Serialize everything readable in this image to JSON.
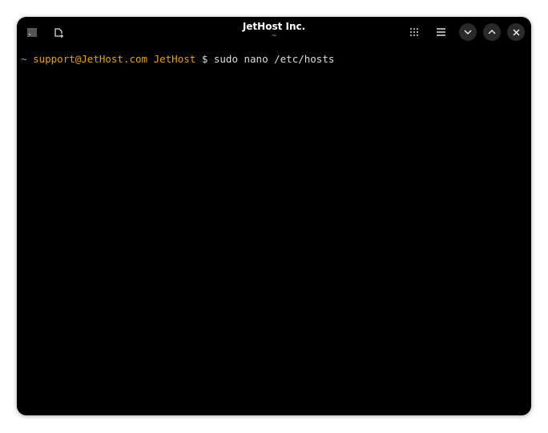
{
  "window": {
    "title": "JetHost Inc.",
    "subtitle": "~"
  },
  "terminal": {
    "tilde": "~",
    "user_host": "support@JetHost.com",
    "dir": "JetHost",
    "prompt": "$",
    "command": "sudo nano /etc/hosts"
  },
  "colors": {
    "prompt": "#e5a100",
    "background": "#000000"
  }
}
